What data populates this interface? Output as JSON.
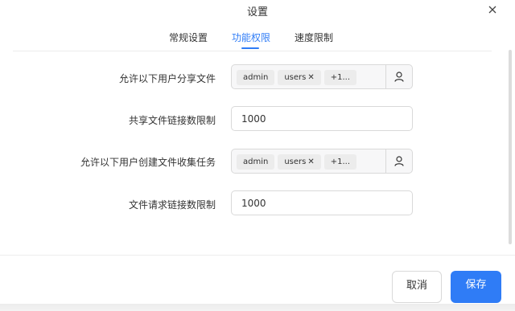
{
  "dialog": {
    "title": "设置"
  },
  "tabs": [
    {
      "label": "常规设置"
    },
    {
      "label": "功能权限"
    },
    {
      "label": "速度限制"
    }
  ],
  "settings": {
    "share_users": {
      "label": "允许以下用户分享文件",
      "chips": [
        "admin",
        "users",
        "+1..."
      ]
    },
    "share_link_limit": {
      "label": "共享文件链接数限制",
      "value": "1000"
    },
    "collect_users": {
      "label": "允许以下用户创建文件收集任务",
      "chips": [
        "admin",
        "users",
        "+1..."
      ]
    },
    "request_link_limit": {
      "label": "文件请求链接数限制",
      "value": "1000"
    }
  },
  "footer": {
    "cancel_label": "取消",
    "save_label": "保存"
  },
  "colors": {
    "accent": "#2f7cf6",
    "border": "#d9d9d9"
  }
}
